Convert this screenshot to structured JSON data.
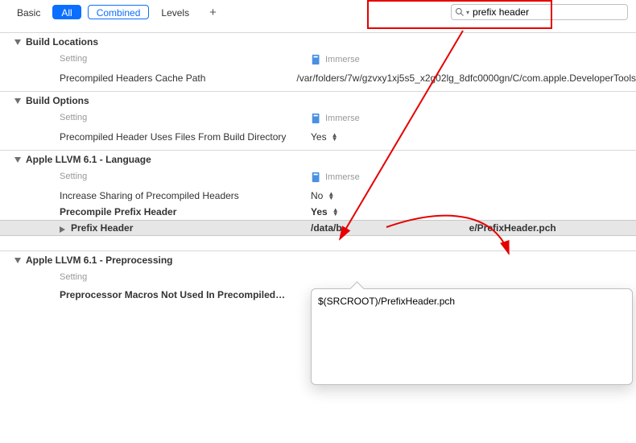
{
  "toolbar": {
    "basic": "Basic",
    "all": "All",
    "combined": "Combined",
    "levels": "Levels"
  },
  "search": {
    "value": "prefix header"
  },
  "columns": {
    "setting": "Setting",
    "target": "Immerse"
  },
  "sections": {
    "buildLocations": {
      "title": "Build Locations",
      "rows": [
        {
          "key": "Precompiled Headers Cache Path",
          "value": "/var/folders/7w/gzvxy1xj5s5_x2g02lg_8dfc0000gn/C/com.apple.DeveloperTools"
        }
      ]
    },
    "buildOptions": {
      "title": "Build Options",
      "rows": [
        {
          "key": "Precompiled Header Uses Files From Build Directory",
          "value": "Yes"
        }
      ]
    },
    "llvmLanguage": {
      "title": "Apple LLVM 6.1 - Language",
      "rows": [
        {
          "key": "Increase Sharing of Precompiled Headers",
          "value": "No"
        },
        {
          "key": "Precompile Prefix Header",
          "value": "Yes"
        },
        {
          "key": "Prefix Header",
          "value_left": "/data/b",
          "value_right": "e/PrefixHeader.pch"
        }
      ]
    },
    "llvmPreprocessing": {
      "title": "Apple LLVM 6.1 - Preprocessing",
      "rows": [
        {
          "key": "Preprocessor Macros Not Used In Precompiled…"
        }
      ]
    }
  },
  "popover": {
    "value": "$(SRCROOT)/PrefixHeader.pch"
  }
}
